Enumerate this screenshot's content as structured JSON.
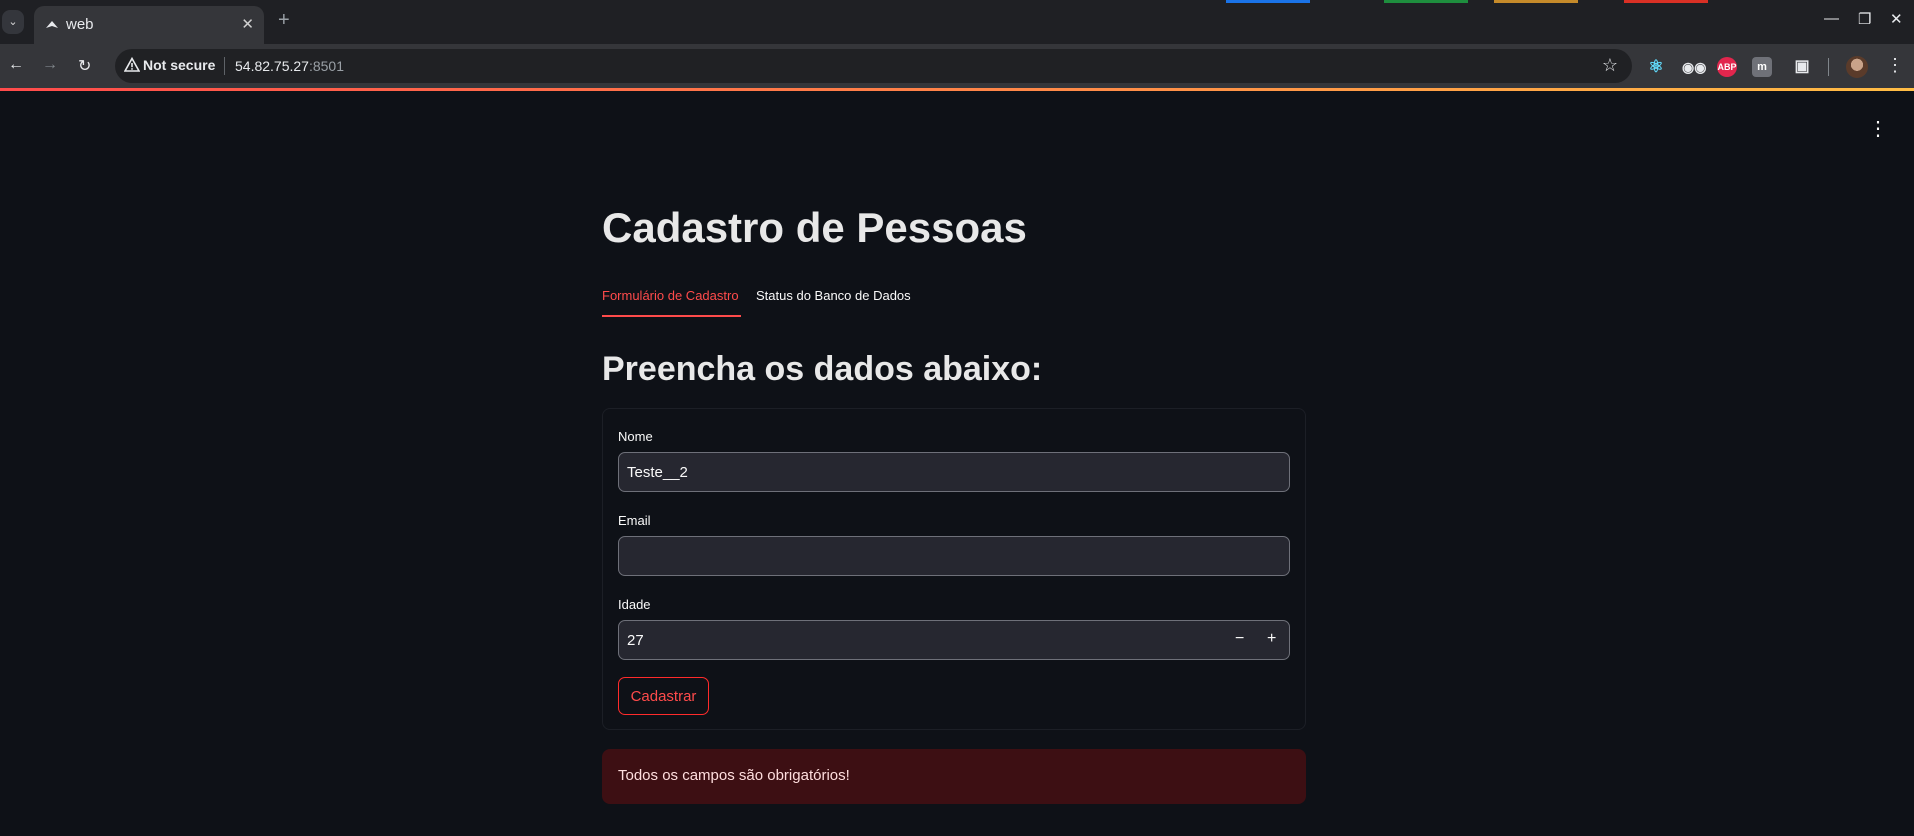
{
  "browser": {
    "tab_title": "web",
    "security_label": "Not secure",
    "url_host": "54.82.75.27",
    "url_port": ":8501"
  },
  "app": {
    "title": "Cadastro de Pessoas",
    "tabs": [
      {
        "label": "Formulário de Cadastro",
        "active": true
      },
      {
        "label": "Status do Banco de Dados",
        "active": false
      }
    ],
    "section_title": "Preencha os dados abaixo:",
    "form": {
      "name_label": "Nome",
      "name_value": "Teste__2",
      "email_label": "Email",
      "email_value": "",
      "age_label": "Idade",
      "age_value": "27",
      "submit_label": "Cadastrar"
    },
    "error_message": "Todos os campos são obrigatórios!"
  },
  "colors": {
    "accent": "#ff4b4b",
    "background": "#0e1117",
    "error_bg": "#3d0f13"
  }
}
